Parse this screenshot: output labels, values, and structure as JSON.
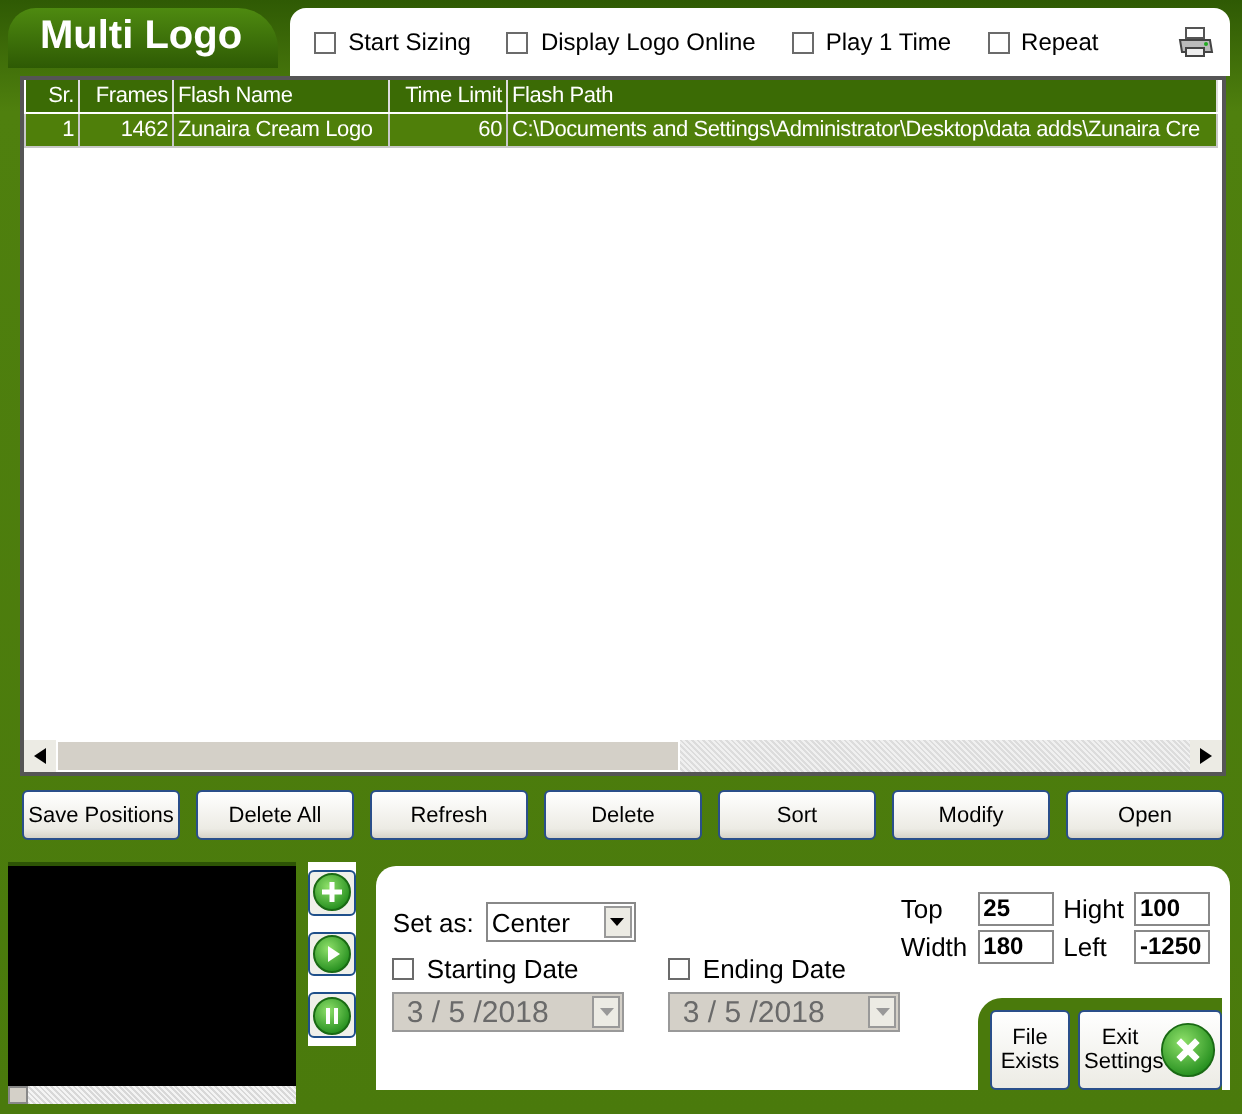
{
  "window": {
    "title": "Multi Logo"
  },
  "options": [
    {
      "label": "Start Sizing",
      "checked": false
    },
    {
      "label": "Display Logo Online",
      "checked": false
    },
    {
      "label": "Play 1 Time",
      "checked": false
    },
    {
      "label": "Repeat",
      "checked": false
    }
  ],
  "table": {
    "columns": [
      "Sr.",
      "Frames",
      "Flash Name",
      "Time Limit",
      "Flash Path"
    ],
    "rows": [
      {
        "cells": [
          "1",
          "1462",
          "Zunaira Cream Logo",
          "60",
          "C:\\Documents and Settings\\Administrator\\Desktop\\data adds\\Zunaira Cre"
        ],
        "selected": true
      }
    ]
  },
  "buttons": [
    "Save Positions",
    "Delete All",
    "Refresh",
    "Delete",
    "Sort",
    "Modify",
    "Open"
  ],
  "settings": {
    "set_as": {
      "label": "Set as:",
      "value": "Center"
    },
    "dates": [
      {
        "label": "Starting Date",
        "checked": false,
        "value": "3 / 5 /2018",
        "disabled": true
      },
      {
        "label": "Ending Date",
        "checked": false,
        "value": "3 / 5 /2018",
        "disabled": true
      }
    ],
    "fields": [
      {
        "label": "Top",
        "value": "25"
      },
      {
        "label": "Hight",
        "value": "100"
      },
      {
        "label": "Width",
        "value": "180"
      },
      {
        "label": "Left",
        "value": "-1250"
      }
    ]
  },
  "side_buttons": [
    "File Exists",
    "Exit Settings"
  ]
}
